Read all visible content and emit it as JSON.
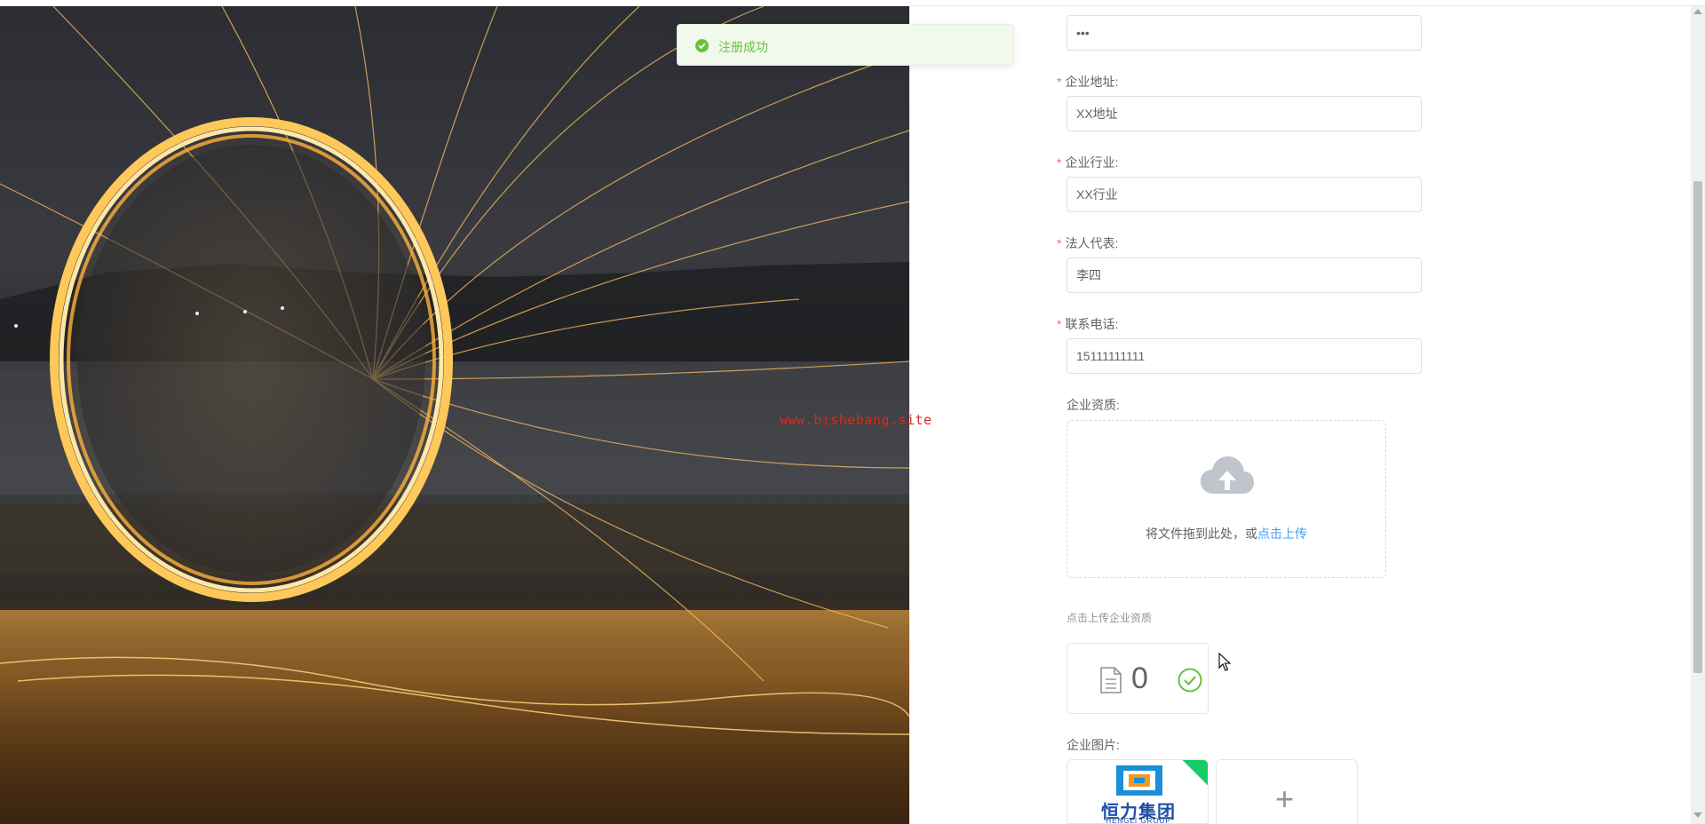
{
  "form": {
    "password_value": "•••",
    "fields": [
      {
        "label": "企业地址:",
        "value": "XX地址",
        "required": true
      },
      {
        "label": "企业行业:",
        "value": "XX行业",
        "required": true
      },
      {
        "label": "法人代表:",
        "value": "李四",
        "required": true
      },
      {
        "label": "联系电话:",
        "value": "15111111111",
        "required": true
      }
    ],
    "qualification_label": "企业资质:",
    "upload": {
      "icon": "upload-cloud-icon",
      "text_prefix": "将文件拖到此处，或",
      "text_link": "点击上传"
    },
    "tip": "点击上传企业资质",
    "file_card": {
      "icon": "document-icon",
      "count": "0",
      "status_icon": "success-check-icon"
    },
    "image_label": "企业图片:",
    "image_card": {
      "logo_text": "恒力集团",
      "logo_sub": "HENGLI GROUP"
    },
    "add_icon": "+"
  },
  "toast": {
    "icon": "success-circle-icon",
    "message": "注册成功",
    "color": "#67c23a"
  },
  "watermark": "www.bishebang.site",
  "colors": {
    "required": "#f56c6c",
    "link": "#409eff",
    "success": "#13ce66"
  }
}
